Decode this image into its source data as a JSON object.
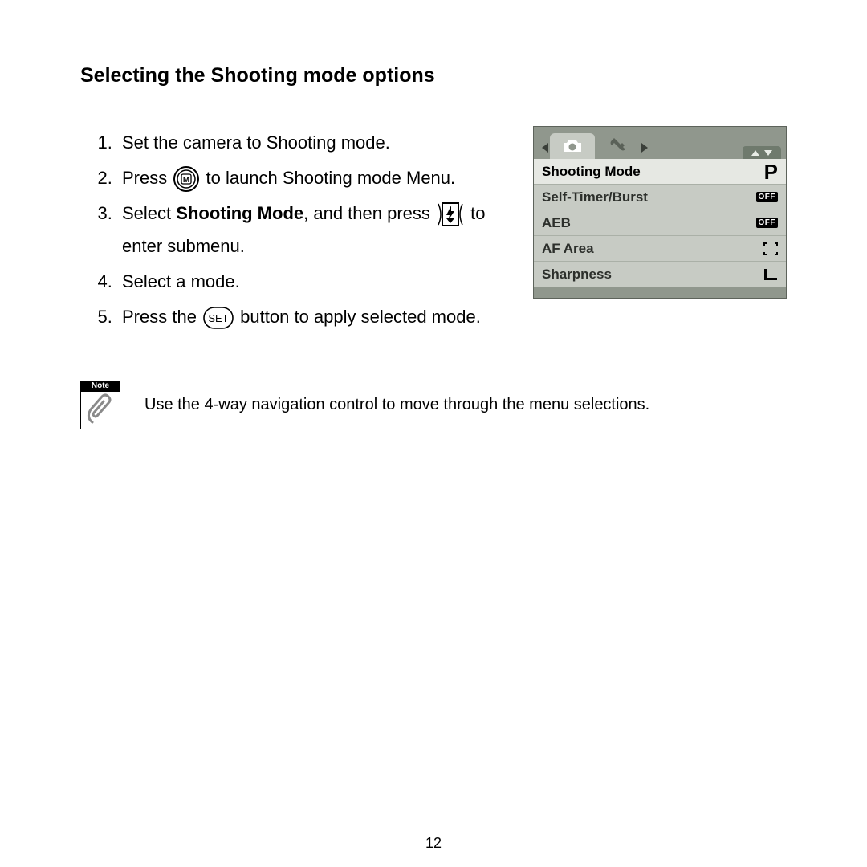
{
  "heading": "Selecting the Shooting mode options",
  "steps": {
    "s1": "Set the camera to Shooting mode.",
    "s2a": "Press ",
    "s2b": " to launch Shooting mode Menu.",
    "s3a": "Select ",
    "s3bold": "Shooting Mode",
    "s3b": ", and then press ",
    "s3c": " to enter submenu.",
    "s4": "Select a mode.",
    "s5a": "Press the ",
    "s5b": " button to apply selected mode."
  },
  "note": {
    "label": "Note",
    "text": "Use the 4-way navigation control to move through the menu selections."
  },
  "lcd": {
    "rows": [
      {
        "label": "Shooting Mode",
        "value": "P",
        "valueType": "P",
        "selected": true
      },
      {
        "label": "Self-Timer/Burst",
        "value": "OFF",
        "valueType": "OFF",
        "selected": false
      },
      {
        "label": "AEB",
        "value": "OFF",
        "valueType": "OFF",
        "selected": false
      },
      {
        "label": "AF Area",
        "value": "",
        "valueType": "AFAREA",
        "selected": false
      },
      {
        "label": "Sharpness",
        "value": "",
        "valueType": "SHARP",
        "selected": false
      }
    ]
  },
  "icons": {
    "m_button": "M",
    "set_button": "SET"
  },
  "pageNumber": "12"
}
